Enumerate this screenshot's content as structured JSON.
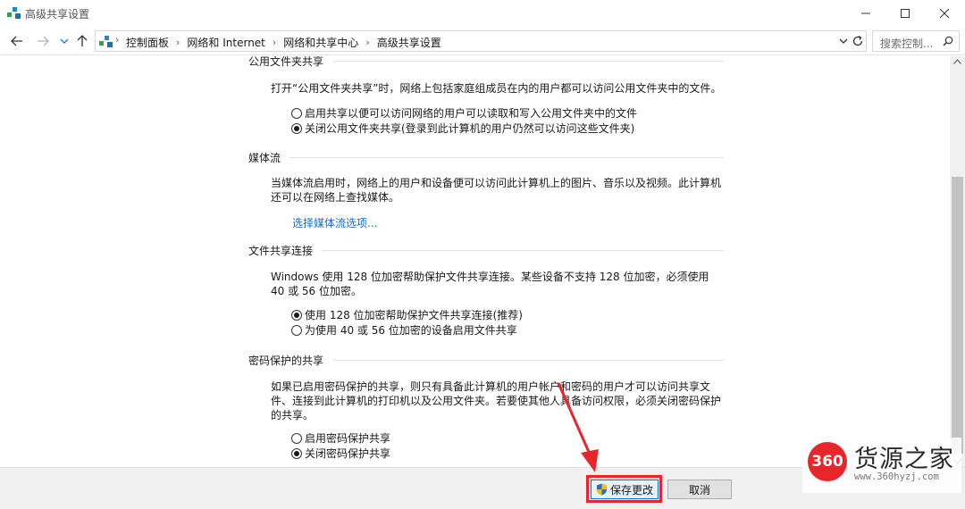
{
  "window": {
    "title": "高级共享设置"
  },
  "nav": {
    "breadcrumbs": [
      "控制面板",
      "网络和 Internet",
      "网络和共享中心",
      "高级共享设置"
    ],
    "search_placeholder": "搜索控制..."
  },
  "sections": {
    "public_folder": {
      "heading": "公用文件夹共享",
      "description": "打开“公用文件夹共享”时，网络上包括家庭组成员在内的用户都可以访问公用文件夹中的文件。",
      "options": [
        {
          "label": "启用共享以便可以访问网络的用户可以读取和写入公用文件夹中的文件",
          "selected": false
        },
        {
          "label": "关闭公用文件夹共享(登录到此计算机的用户仍然可以访问这些文件夹)",
          "selected": true
        }
      ]
    },
    "media_streaming": {
      "heading": "媒体流",
      "description": "当媒体流启用时，网络上的用户和设备便可以访问此计算机上的图片、音乐以及视频。此计算机还可以在网络上查找媒体。",
      "link": "选择媒体流选项..."
    },
    "file_sharing": {
      "heading": "文件共享连接",
      "description": "Windows 使用 128 位加密帮助保护文件共享连接。某些设备不支持 128 位加密，必须使用 40 或 56 位加密。",
      "options": [
        {
          "label": "使用 128 位加密帮助保护文件共享连接(推荐)",
          "selected": true
        },
        {
          "label": "为使用 40 或 56 位加密的设备启用文件共享",
          "selected": false
        }
      ]
    },
    "password": {
      "heading": "密码保护的共享",
      "description": "如果已启用密码保护的共享，则只有具备此计算机的用户帐户和密码的用户才可以访问共享文件、连接到此计算机的打印机以及公用文件夹。若要使其他人具备访问权限，必须关闭密码保护的共享。",
      "options": [
        {
          "label": "启用密码保护共享",
          "selected": false
        },
        {
          "label": "关闭密码保护共享",
          "selected": true
        }
      ]
    }
  },
  "buttons": {
    "save": "保存更改",
    "cancel": "取消"
  },
  "watermark": {
    "badge": "360",
    "brand": "货源之家",
    "url": "www.360hyzj.com"
  },
  "colors": {
    "link": "#1a6cd1",
    "highlight": "#e8262a",
    "save_border": "#0078d7"
  }
}
